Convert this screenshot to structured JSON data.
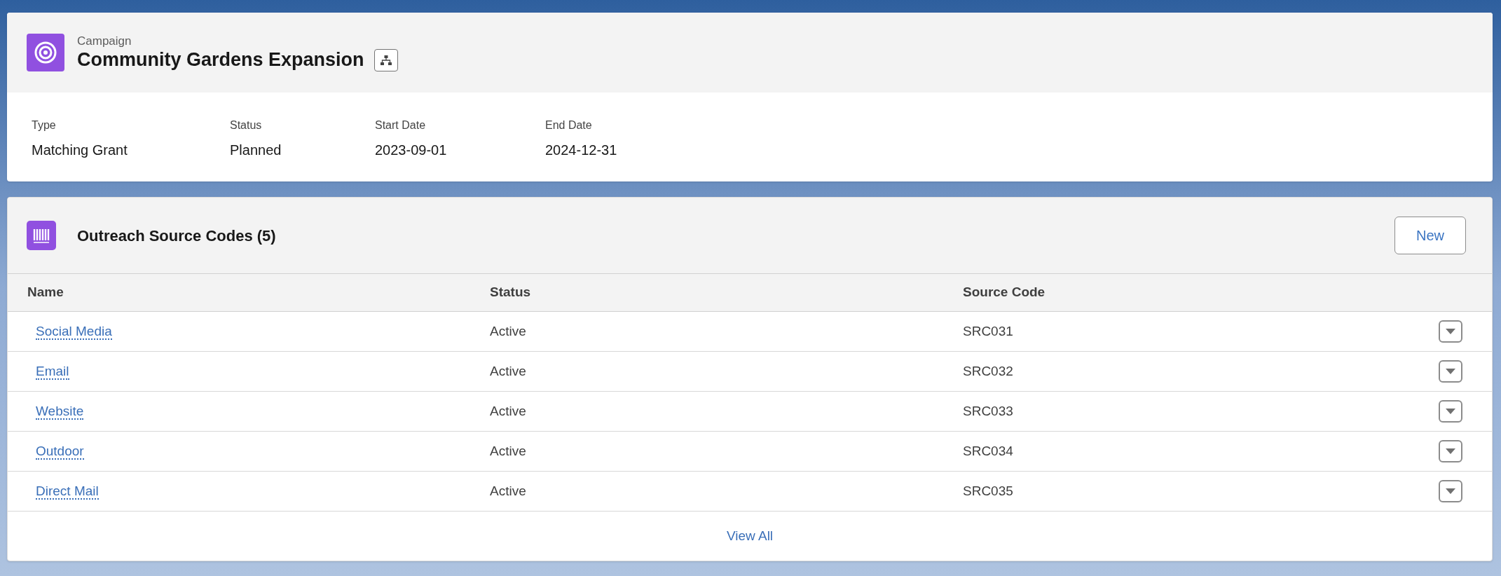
{
  "record": {
    "object_label": "Campaign",
    "title": "Community Gardens Expansion",
    "fields": [
      {
        "label": "Type",
        "value": "Matching Grant"
      },
      {
        "label": "Status",
        "value": "Planned"
      },
      {
        "label": "Start Date",
        "value": "2023-09-01"
      },
      {
        "label": "End Date",
        "value": "2024-12-31"
      }
    ]
  },
  "related_list": {
    "title": "Outreach Source Codes (5)",
    "new_button": "New",
    "columns": [
      "Name",
      "Status",
      "Source Code"
    ],
    "rows": [
      {
        "name": "Social Media",
        "status": "Active",
        "source_code": "SRC031"
      },
      {
        "name": "Email",
        "status": "Active",
        "source_code": "SRC032"
      },
      {
        "name": "Website",
        "status": "Active",
        "source_code": "SRC033"
      },
      {
        "name": "Outdoor",
        "status": "Active",
        "source_code": "SRC034"
      },
      {
        "name": "Direct Mail",
        "status": "Active",
        "source_code": "SRC035"
      }
    ],
    "footer_link": "View All"
  }
}
